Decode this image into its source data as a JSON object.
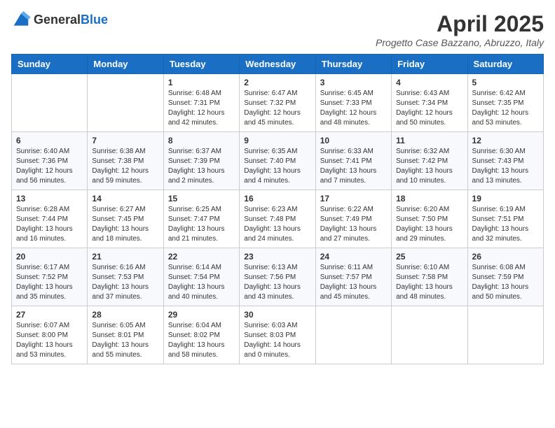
{
  "logo": {
    "general": "General",
    "blue": "Blue"
  },
  "title": "April 2025",
  "subtitle": "Progetto Case Bazzano, Abruzzo, Italy",
  "weekdays": [
    "Sunday",
    "Monday",
    "Tuesday",
    "Wednesday",
    "Thursday",
    "Friday",
    "Saturday"
  ],
  "weeks": [
    [
      {
        "day": "",
        "sunrise": "",
        "sunset": "",
        "daylight": ""
      },
      {
        "day": "",
        "sunrise": "",
        "sunset": "",
        "daylight": ""
      },
      {
        "day": "1",
        "sunrise": "Sunrise: 6:48 AM",
        "sunset": "Sunset: 7:31 PM",
        "daylight": "Daylight: 12 hours and 42 minutes."
      },
      {
        "day": "2",
        "sunrise": "Sunrise: 6:47 AM",
        "sunset": "Sunset: 7:32 PM",
        "daylight": "Daylight: 12 hours and 45 minutes."
      },
      {
        "day": "3",
        "sunrise": "Sunrise: 6:45 AM",
        "sunset": "Sunset: 7:33 PM",
        "daylight": "Daylight: 12 hours and 48 minutes."
      },
      {
        "day": "4",
        "sunrise": "Sunrise: 6:43 AM",
        "sunset": "Sunset: 7:34 PM",
        "daylight": "Daylight: 12 hours and 50 minutes."
      },
      {
        "day": "5",
        "sunrise": "Sunrise: 6:42 AM",
        "sunset": "Sunset: 7:35 PM",
        "daylight": "Daylight: 12 hours and 53 minutes."
      }
    ],
    [
      {
        "day": "6",
        "sunrise": "Sunrise: 6:40 AM",
        "sunset": "Sunset: 7:36 PM",
        "daylight": "Daylight: 12 hours and 56 minutes."
      },
      {
        "day": "7",
        "sunrise": "Sunrise: 6:38 AM",
        "sunset": "Sunset: 7:38 PM",
        "daylight": "Daylight: 12 hours and 59 minutes."
      },
      {
        "day": "8",
        "sunrise": "Sunrise: 6:37 AM",
        "sunset": "Sunset: 7:39 PM",
        "daylight": "Daylight: 13 hours and 2 minutes."
      },
      {
        "day": "9",
        "sunrise": "Sunrise: 6:35 AM",
        "sunset": "Sunset: 7:40 PM",
        "daylight": "Daylight: 13 hours and 4 minutes."
      },
      {
        "day": "10",
        "sunrise": "Sunrise: 6:33 AM",
        "sunset": "Sunset: 7:41 PM",
        "daylight": "Daylight: 13 hours and 7 minutes."
      },
      {
        "day": "11",
        "sunrise": "Sunrise: 6:32 AM",
        "sunset": "Sunset: 7:42 PM",
        "daylight": "Daylight: 13 hours and 10 minutes."
      },
      {
        "day": "12",
        "sunrise": "Sunrise: 6:30 AM",
        "sunset": "Sunset: 7:43 PM",
        "daylight": "Daylight: 13 hours and 13 minutes."
      }
    ],
    [
      {
        "day": "13",
        "sunrise": "Sunrise: 6:28 AM",
        "sunset": "Sunset: 7:44 PM",
        "daylight": "Daylight: 13 hours and 16 minutes."
      },
      {
        "day": "14",
        "sunrise": "Sunrise: 6:27 AM",
        "sunset": "Sunset: 7:45 PM",
        "daylight": "Daylight: 13 hours and 18 minutes."
      },
      {
        "day": "15",
        "sunrise": "Sunrise: 6:25 AM",
        "sunset": "Sunset: 7:47 PM",
        "daylight": "Daylight: 13 hours and 21 minutes."
      },
      {
        "day": "16",
        "sunrise": "Sunrise: 6:23 AM",
        "sunset": "Sunset: 7:48 PM",
        "daylight": "Daylight: 13 hours and 24 minutes."
      },
      {
        "day": "17",
        "sunrise": "Sunrise: 6:22 AM",
        "sunset": "Sunset: 7:49 PM",
        "daylight": "Daylight: 13 hours and 27 minutes."
      },
      {
        "day": "18",
        "sunrise": "Sunrise: 6:20 AM",
        "sunset": "Sunset: 7:50 PM",
        "daylight": "Daylight: 13 hours and 29 minutes."
      },
      {
        "day": "19",
        "sunrise": "Sunrise: 6:19 AM",
        "sunset": "Sunset: 7:51 PM",
        "daylight": "Daylight: 13 hours and 32 minutes."
      }
    ],
    [
      {
        "day": "20",
        "sunrise": "Sunrise: 6:17 AM",
        "sunset": "Sunset: 7:52 PM",
        "daylight": "Daylight: 13 hours and 35 minutes."
      },
      {
        "day": "21",
        "sunrise": "Sunrise: 6:16 AM",
        "sunset": "Sunset: 7:53 PM",
        "daylight": "Daylight: 13 hours and 37 minutes."
      },
      {
        "day": "22",
        "sunrise": "Sunrise: 6:14 AM",
        "sunset": "Sunset: 7:54 PM",
        "daylight": "Daylight: 13 hours and 40 minutes."
      },
      {
        "day": "23",
        "sunrise": "Sunrise: 6:13 AM",
        "sunset": "Sunset: 7:56 PM",
        "daylight": "Daylight: 13 hours and 43 minutes."
      },
      {
        "day": "24",
        "sunrise": "Sunrise: 6:11 AM",
        "sunset": "Sunset: 7:57 PM",
        "daylight": "Daylight: 13 hours and 45 minutes."
      },
      {
        "day": "25",
        "sunrise": "Sunrise: 6:10 AM",
        "sunset": "Sunset: 7:58 PM",
        "daylight": "Daylight: 13 hours and 48 minutes."
      },
      {
        "day": "26",
        "sunrise": "Sunrise: 6:08 AM",
        "sunset": "Sunset: 7:59 PM",
        "daylight": "Daylight: 13 hours and 50 minutes."
      }
    ],
    [
      {
        "day": "27",
        "sunrise": "Sunrise: 6:07 AM",
        "sunset": "Sunset: 8:00 PM",
        "daylight": "Daylight: 13 hours and 53 minutes."
      },
      {
        "day": "28",
        "sunrise": "Sunrise: 6:05 AM",
        "sunset": "Sunset: 8:01 PM",
        "daylight": "Daylight: 13 hours and 55 minutes."
      },
      {
        "day": "29",
        "sunrise": "Sunrise: 6:04 AM",
        "sunset": "Sunset: 8:02 PM",
        "daylight": "Daylight: 13 hours and 58 minutes."
      },
      {
        "day": "30",
        "sunrise": "Sunrise: 6:03 AM",
        "sunset": "Sunset: 8:03 PM",
        "daylight": "Daylight: 14 hours and 0 minutes."
      },
      {
        "day": "",
        "sunrise": "",
        "sunset": "",
        "daylight": ""
      },
      {
        "day": "",
        "sunrise": "",
        "sunset": "",
        "daylight": ""
      },
      {
        "day": "",
        "sunrise": "",
        "sunset": "",
        "daylight": ""
      }
    ]
  ]
}
